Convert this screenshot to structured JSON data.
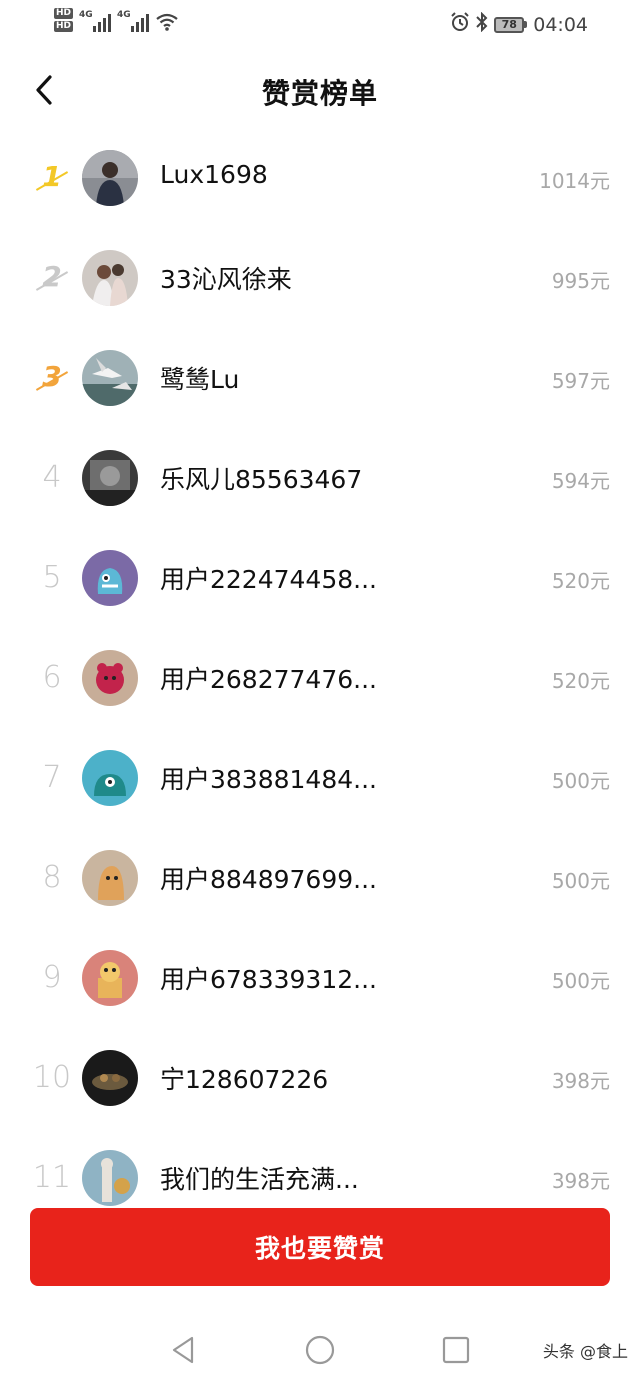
{
  "status_bar": {
    "hd_badges": [
      "HD",
      "HD"
    ],
    "network_labels": [
      "4G",
      "4G"
    ],
    "battery_level": "78",
    "time": "04:04",
    "icons": [
      "hd-icon",
      "signal-icon",
      "wifi-icon",
      "alarm-icon",
      "bluetooth-icon",
      "battery-icon"
    ]
  },
  "header": {
    "back_icon": "chevron-left-icon",
    "title": "赞赏榜单"
  },
  "ranking": [
    {
      "rank": "1",
      "name": "Lux1698",
      "amount": "1014元"
    },
    {
      "rank": "2",
      "name": "33沁风徐来",
      "amount": "995元"
    },
    {
      "rank": "3",
      "name": "鹭鸶Lu",
      "amount": "597元"
    },
    {
      "rank": "4",
      "name": "乐风儿85563467",
      "amount": "594元"
    },
    {
      "rank": "5",
      "name": "用户222474458...",
      "amount": "520元"
    },
    {
      "rank": "6",
      "name": "用户268277476...",
      "amount": "520元"
    },
    {
      "rank": "7",
      "name": "用户383881484...",
      "amount": "500元"
    },
    {
      "rank": "8",
      "name": "用户884897699...",
      "amount": "500元"
    },
    {
      "rank": "9",
      "name": "用户678339312...",
      "amount": "500元"
    },
    {
      "rank": "10",
      "name": "宁128607226",
      "amount": "398元"
    },
    {
      "rank": "11",
      "name": "我们的生活充满...",
      "amount": "398元"
    }
  ],
  "action_button": {
    "label": "我也要赞赏"
  },
  "nav_bar": {
    "icons": [
      "back-triangle-icon",
      "home-circle-icon",
      "recents-square-icon"
    ],
    "watermark": "头条 @食上"
  },
  "colors": {
    "accent": "#e8231b",
    "gold": "#f3c827",
    "silver": "#c9c9c9",
    "bronze": "#f2a43b",
    "muted_text": "#a8a8a8"
  }
}
